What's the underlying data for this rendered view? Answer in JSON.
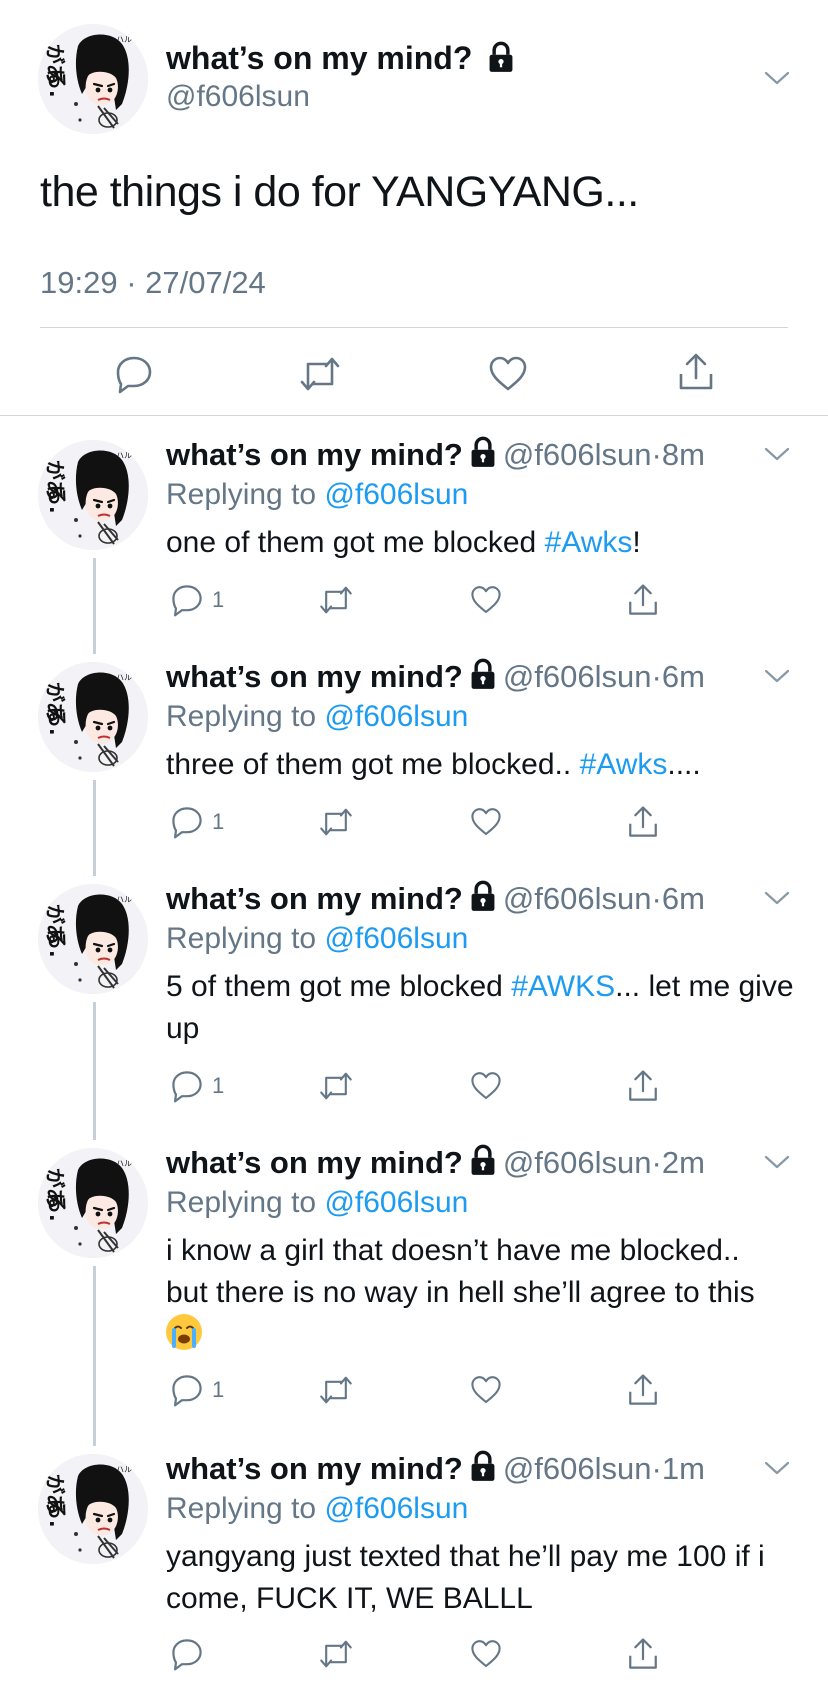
{
  "main_tweet": {
    "name": "what’s on my mind?",
    "handle": "@f606lsun",
    "text": "the things i do for YANGYANG...",
    "timestamp": "19:29 · 27/07/24"
  },
  "replies": [
    {
      "name": "what’s on my mind?",
      "handle": "@f606lsun",
      "time": "8m",
      "replying_prefix": "Replying to ",
      "replying_to": "@f606lsun",
      "text_before": "one of them got me blocked ",
      "hashtag": "#Awks",
      "text_after": "!",
      "reply_count": "1"
    },
    {
      "name": "what’s on my mind?",
      "handle": "@f606lsun",
      "time": "6m",
      "replying_prefix": "Replying to ",
      "replying_to": "@f606lsun",
      "text_before": "three of them got me blocked.. ",
      "hashtag": "#Awks",
      "text_after": "....",
      "reply_count": "1"
    },
    {
      "name": "what’s on my mind?",
      "handle": "@f606lsun",
      "time": "6m",
      "replying_prefix": "Replying to ",
      "replying_to": "@f606lsun",
      "text_before": "5 of them got me blocked ",
      "hashtag": "#AWKS",
      "text_after": "... let me give up",
      "reply_count": "1"
    },
    {
      "name": "what’s on my mind?",
      "handle": "@f606lsun",
      "time": "2m",
      "replying_prefix": "Replying to ",
      "replying_to": "@f606lsun",
      "text_before": "i know a girl that doesn’t have me blocked.. but there is no way in hell she’ll agree to this",
      "emoji": "loudly-crying-face-emoji",
      "reply_count": "1"
    },
    {
      "name": "what’s on my mind?",
      "handle": "@f606lsun",
      "time": "1m",
      "replying_prefix": "Replying to ",
      "replying_to": "@f606lsun",
      "text_before": "yangyang just texted that he’ll pay me 100 if i come, FUCK IT, WE BALLL",
      "reply_count": ""
    }
  ],
  "meta_separator": "·",
  "icons": {
    "lock": "lock-icon",
    "chevron": "chevron-down-icon",
    "reply": "reply-icon",
    "retweet": "retweet-icon",
    "like": "heart-icon",
    "share": "share-icon"
  },
  "colors": {
    "link": "#1d9bf0",
    "secondary_text": "#657786",
    "divider": "#d0d6da",
    "thread_line": "#c7d0d8"
  }
}
